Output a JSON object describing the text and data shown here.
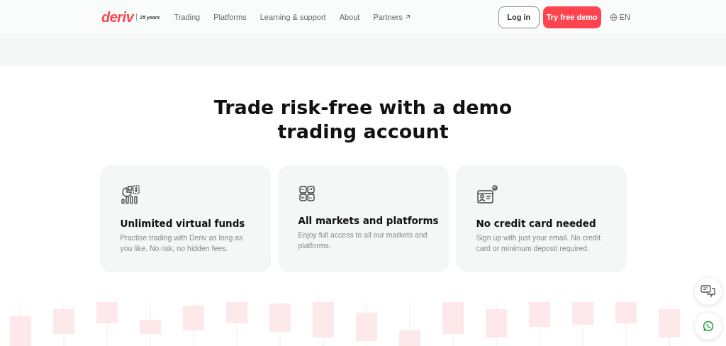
{
  "header": {
    "logo": "deriv",
    "anniversary": "25 years",
    "nav": [
      {
        "label": "Trading",
        "external": false
      },
      {
        "label": "Platforms",
        "external": false
      },
      {
        "label": "Learning & support",
        "external": false
      },
      {
        "label": "About",
        "external": false
      },
      {
        "label": "Partners",
        "external": true
      }
    ],
    "login": "Log in",
    "cta": "Try free demo",
    "language": "EN"
  },
  "hero": {
    "title": "Trade risk-free with a demo trading account"
  },
  "features": [
    {
      "kind": "funds",
      "title": "Unlimited virtual funds",
      "text": "Practise trading with Deriv as long as you like. No risk, no hidden fees."
    },
    {
      "kind": "markets",
      "title": "All markets and platforms",
      "text": "Enjoy full access to all our markets and platforms."
    },
    {
      "kind": "card",
      "title": "No credit card needed",
      "text": "Sign up with just your email. No credit card or minimum deposit required."
    }
  ]
}
